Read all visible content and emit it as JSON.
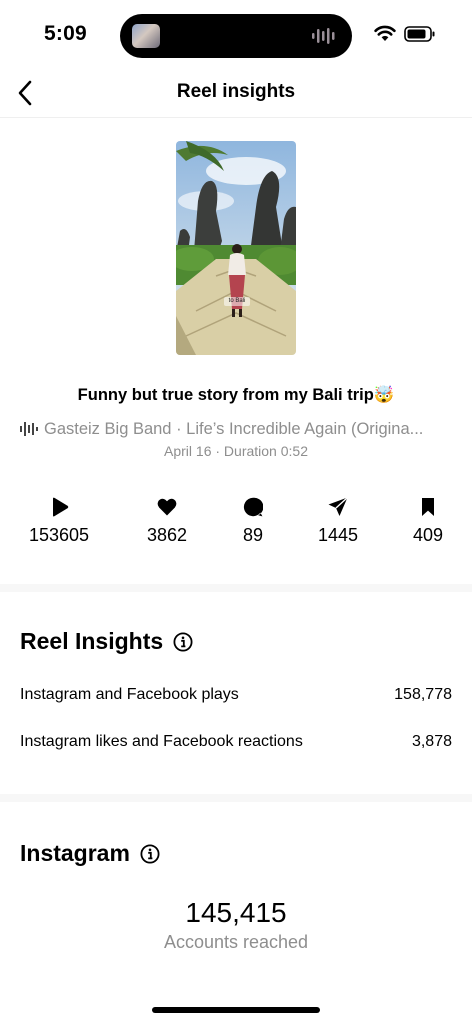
{
  "status_bar": {
    "time": "5:09"
  },
  "header": {
    "title": "Reel insights"
  },
  "reel": {
    "title": "Funny but true story from my Bali trip🤯",
    "audio": "Gasteiz Big Band · Life’s Incredible Again (Origina...",
    "meta": "April 16 · Duration 0:52",
    "overlay_text": "to Bali"
  },
  "stats": [
    {
      "icon": "play-icon",
      "value": "153605"
    },
    {
      "icon": "heart-icon",
      "value": "3862"
    },
    {
      "icon": "comment-icon",
      "value": "89"
    },
    {
      "icon": "send-icon",
      "value": "1445"
    },
    {
      "icon": "bookmark-icon",
      "value": "409"
    }
  ],
  "reel_insights": {
    "title": "Reel Insights",
    "rows": [
      {
        "label": "Instagram and Facebook plays",
        "value": "158,778"
      },
      {
        "label": "Instagram likes and Facebook reactions",
        "value": "3,878"
      }
    ]
  },
  "instagram": {
    "title": "Instagram",
    "accounts_reached": "145,415",
    "accounts_reached_label": "Accounts reached"
  }
}
